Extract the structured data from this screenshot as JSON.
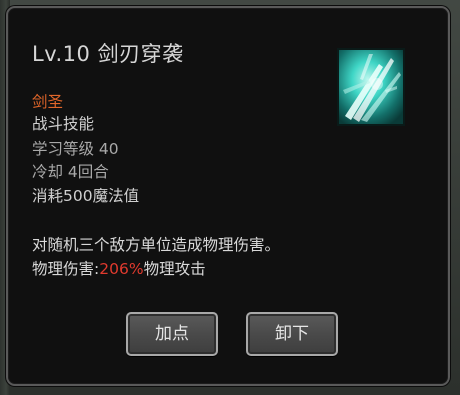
{
  "skill": {
    "title": "Lv.10 剑刃穿袭",
    "icon": "sword-strike-icon",
    "class_name": "剑圣",
    "type": "战斗技能",
    "learn_level": "学习等级 40",
    "cooldown": "冷却 4回合",
    "mp_cost": "消耗500魔法值",
    "description": "对随机三个敌方单位造成物理伤害。",
    "damage_prefix": "物理伤害:",
    "damage_percent": "206%",
    "damage_suffix": "物理攻击"
  },
  "buttons": {
    "add_point": "加点",
    "unequip": "卸下"
  },
  "colors": {
    "class_name": "#e0662a",
    "damage_percent": "#e03a2e",
    "icon_teal": "#3fd6c6"
  }
}
